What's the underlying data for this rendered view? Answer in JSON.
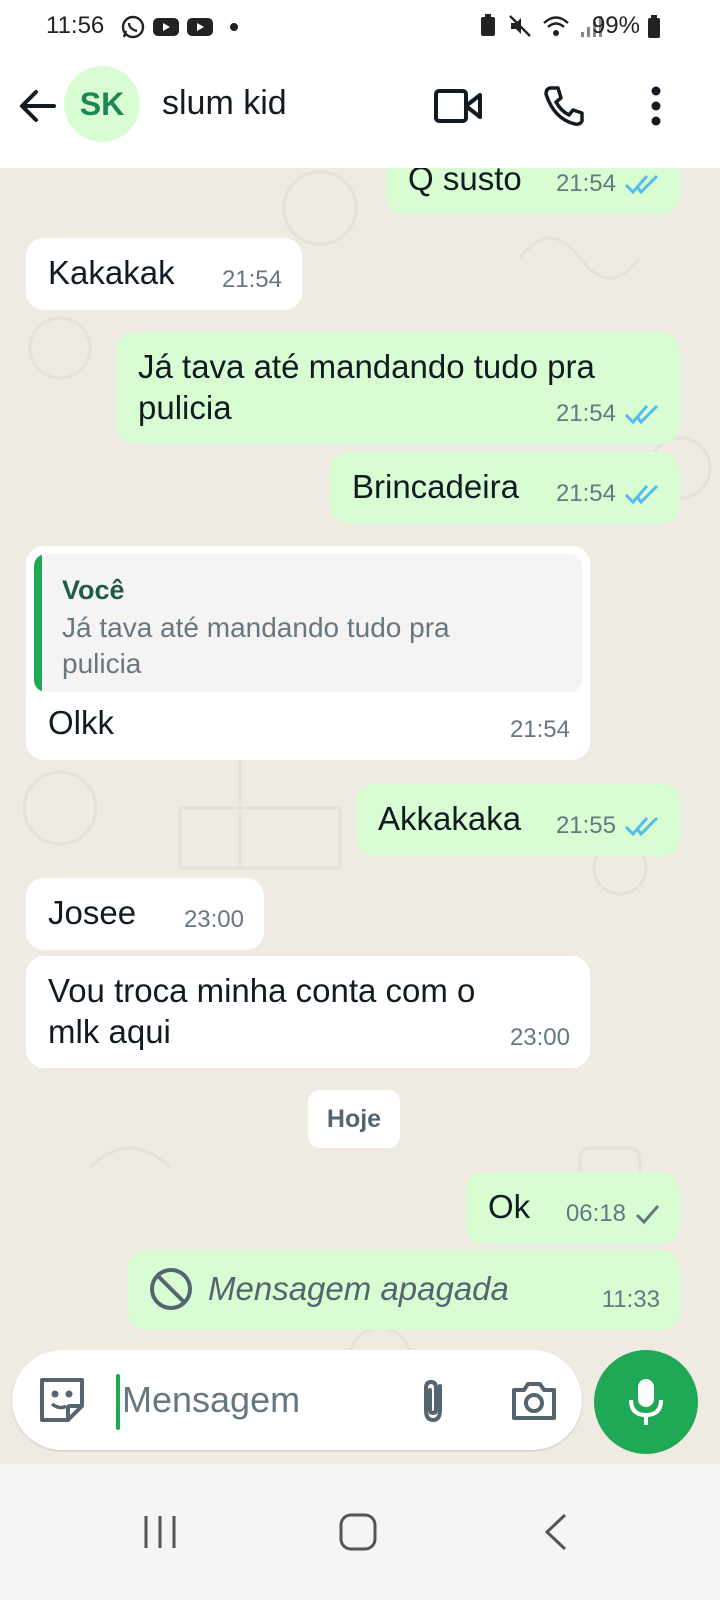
{
  "status_bar": {
    "time": "11:56",
    "battery": "99%"
  },
  "header": {
    "avatar_initials": "SK",
    "contact_name": "slum kid"
  },
  "messages": [
    {
      "dir": "out",
      "text": "Q susto",
      "time": "21:54",
      "status": "read"
    },
    {
      "dir": "in",
      "text": "Kakakak",
      "time": "21:54"
    },
    {
      "dir": "out",
      "text": "Já tava até mandando tudo pra pulicia",
      "line1": "Já tava até mandando tudo pra",
      "line2": "pulicia",
      "time": "21:54",
      "status": "read"
    },
    {
      "dir": "out",
      "text": "Brincadeira",
      "time": "21:54",
      "status": "read"
    },
    {
      "dir": "in",
      "quote_author": "Você",
      "quote_line1": "Já tava até mandando tudo pra",
      "quote_line2": "pulicia",
      "text": "Olkk",
      "time": "21:54"
    },
    {
      "dir": "out",
      "text": "Akkakaka",
      "time": "21:55",
      "status": "read"
    },
    {
      "dir": "in",
      "text": "Josee",
      "time": "23:00"
    },
    {
      "dir": "in",
      "line1": "Vou troca minha conta com o",
      "line2": "mlk aqui",
      "time": "23:00"
    },
    {
      "dir": "out",
      "text": "Ok",
      "time": "06:18",
      "status": "sent"
    },
    {
      "dir": "out",
      "text": "Mensagem apagada",
      "time": "11:33",
      "deleted": true
    }
  ],
  "day_separator": "Hoje",
  "composer": {
    "placeholder": "Mensagem"
  },
  "colors": {
    "accent": "#1fa855",
    "outgoing_bubble": "#d9fdd3",
    "incoming_bubble": "#ffffff",
    "chat_background": "#efeae2",
    "read_tick": "#53bdeb"
  }
}
